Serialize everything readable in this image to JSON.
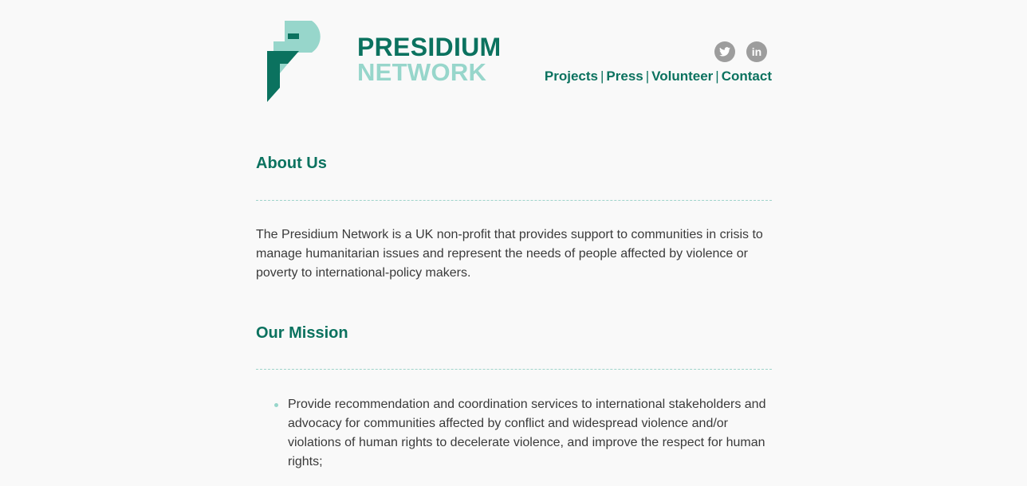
{
  "header": {
    "logo": {
      "word1": "PRESIDIUM",
      "word2": "NETWORK"
    },
    "social": [
      {
        "name": "twitter",
        "glyph": ""
      },
      {
        "name": "linkedin",
        "glyph": "in"
      }
    ],
    "nav": [
      {
        "label": "Projects"
      },
      {
        "label": "Press"
      },
      {
        "label": "Volunteer"
      },
      {
        "label": "Contact"
      }
    ],
    "nav_separator": "|"
  },
  "about": {
    "title": "About Us",
    "text": "The Presidium Network is a UK non-profit that provides support to communities in crisis to manage humanitarian issues and represent the needs of people affected by violence or poverty to international-policy makers."
  },
  "mission": {
    "title": "Our Mission",
    "items": [
      "Provide recommendation and coordination services to international stakeholders and advocacy for communities affected by conflict and widespread violence and/or violations of human rights to decelerate violence, and improve the respect for human rights;"
    ]
  },
  "colors": {
    "primary": "#0b725f",
    "accent": "#97d6cb",
    "icon_bg": "#9d9d9d",
    "text": "#3a3a3a",
    "background": "#f9f9f9"
  }
}
